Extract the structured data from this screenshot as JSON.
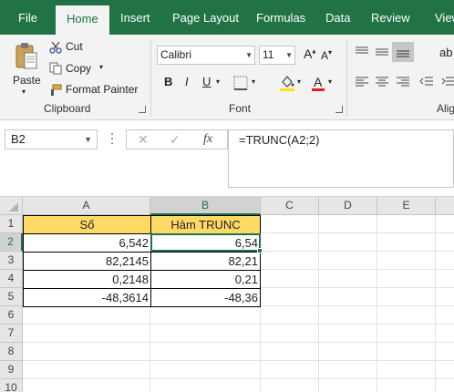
{
  "ribbon_tabs": [
    "File",
    "Home",
    "Insert",
    "Page Layout",
    "Formulas",
    "Data",
    "Review",
    "View"
  ],
  "clipboard": {
    "paste": "Paste",
    "cut": "Cut",
    "copy": "Copy",
    "format_painter": "Format Painter",
    "group_label": "Clipboard"
  },
  "font": {
    "name": "Calibri",
    "size": "11",
    "bold": "B",
    "italic": "I",
    "underline": "U",
    "group_label": "Font"
  },
  "alignment": {
    "group_label": "Alig"
  },
  "formula_bar": {
    "name_box": "B2",
    "cancel": "✕",
    "enter": "✓",
    "fx": "fx",
    "formula": "=TRUNC(A2;2)"
  },
  "columns": [
    "A",
    "B",
    "C",
    "D",
    "E"
  ],
  "rows": [
    "1",
    "2",
    "3",
    "4",
    "5",
    "6",
    "7",
    "8",
    "9",
    "10"
  ],
  "cells": {
    "A1": "Số",
    "B1": "Hàm TRUNC",
    "A2": "6,542",
    "B2": "6,54",
    "A3": "82,2145",
    "B3": "82,21",
    "A4": "0,2148",
    "B4": "0,21",
    "A5": "-48,3614",
    "B5": "-48,36"
  },
  "colors": {
    "accent": "#217346",
    "header_fill": "#ffd966"
  }
}
